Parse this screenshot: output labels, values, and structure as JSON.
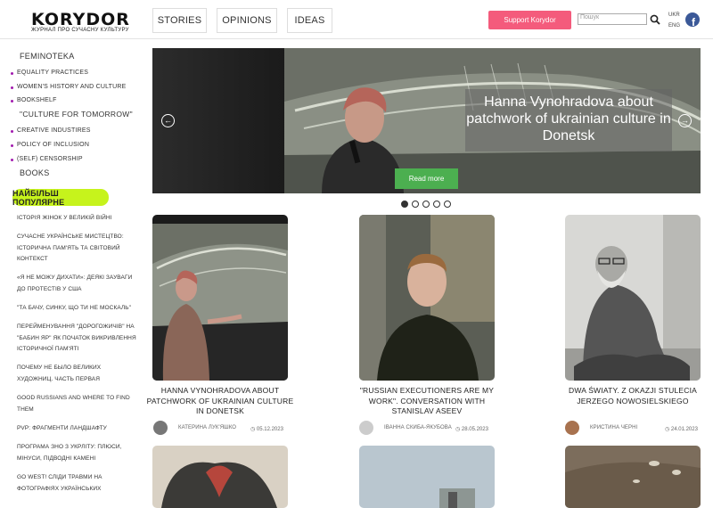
{
  "header": {
    "logo": "KORYDOR",
    "tagline": "ЖУРНАЛ ПРО СУЧАСНУ КУЛЬТУРУ",
    "nav": [
      "STORIES",
      "OPINIONS",
      "IDEAS"
    ],
    "support_label": "Support Korydor",
    "search_placeholder": "Пошук",
    "lang_ukr": "UKR",
    "lang_eng": "ENG",
    "fb": "f"
  },
  "sidebar": {
    "feminoteka": "FEMINOTEKA",
    "items1": [
      "EQUALITY PRACTICES",
      "WOMEN'S HISTORY AND CULTURE",
      "BOOKSHELF"
    ],
    "culture": "\"CULTURE FOR TOMORROW\"",
    "items2": [
      "CREATIVE INDUSTIRES",
      "POLICY OF INCLUSION",
      "(SELF) CENSORSHIP"
    ],
    "books": "BOOKS",
    "popular_label": "НАЙБІЛЬШ ПОПУЛЯРНЕ",
    "popular": [
      "ІСТОРІЯ ЖІНОК У ВЕЛИКІЙ ВІЙНІ",
      "СУЧАСНЕ УКРАЇНСЬКЕ МИСТЕЦТВО: ІСТОРИЧНА ПАМ'ЯТЬ ТА СВІТОВИЙ КОНТЕКСТ",
      "«Я НЕ МОЖУ ДИХАТИ»: ДЕЯКІ ЗАУВАГИ ДО ПРОТЕСТІВ У США",
      "\"ТА БАЧУ, СИНКУ, ЩО ТИ НЕ МОСКАЛЬ\"",
      "ПЕРЕЙМЕНУВАННЯ \"ДОРОГОЖИЧІВ\" НА \"БАБИН ЯР\" ЯК ПОЧАТОК ВИКРИВЛЕННЯ ІСТОРИЧНОЇ ПАМ'ЯТІ",
      "ПОЧЕМУ НЕ БЫЛО ВЕЛИКИХ ХУДОЖНИЦ. ЧАСТЬ ПЕРВАЯ",
      "GOOD RUSSIANS AND WHERE TO FIND THEM",
      "PVP: ФРАГМЕНТИ ЛАНДШАФТУ",
      "ПРОГРАМА ЗНО З УКРЛІТУ: ПЛЮСИ, МІНУСИ, ПІДВОДНІ КАМЕНІ",
      "GO WEST! СЛІДИ ТРАВМИ НА ФОТОГРАФІЯХ УКРАЇНСЬКИХ"
    ]
  },
  "hero": {
    "title": "Hanna Vynohradova about patchwork of ukrainian culture in Donetsk",
    "button": "Read more",
    "prev": "←",
    "next": "→",
    "slide_count": 5,
    "active_slide": 1
  },
  "cards": [
    {
      "title": "HANNA VYNOHRADOVA ABOUT PATCHWORK OF UKRAINIAN CULTURE IN DONETSK",
      "author": "КАТЕРИНА ЛУК'ЯШКО",
      "date": "05.12.2023"
    },
    {
      "title": "\"RUSSIAN EXECUTIONERS ARE MY WORK\". CONVERSATION WITH STANISLAV ASEEV",
      "author": "ІВАННА СКИБА-ЯКУБОВА",
      "date": "28.05.2023"
    },
    {
      "title": "DWA ŚWIATY. Z OKAZJI STULECIA JERZEGO NOWOSIELSKIEGO",
      "author": "КРИСТИНА ЧЕРНІ",
      "date": "24.01.2023"
    }
  ],
  "colors": {
    "accent_pink": "#f45b7c",
    "popular_green": "#c6f31c",
    "read_more_green": "#4caf50",
    "bullet_purple": "#a21caf"
  }
}
